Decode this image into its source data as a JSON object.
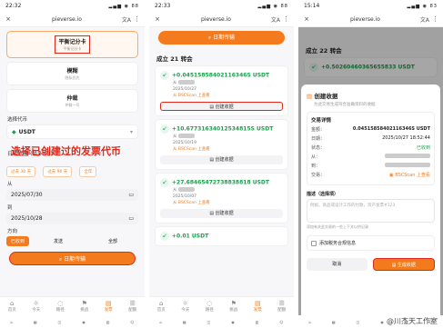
{
  "status": {
    "p1_time": "22:32",
    "p2_time": "22:33",
    "p3_time": "15:14",
    "battery1": "88",
    "battery2": "88",
    "battery3": "83"
  },
  "browser": {
    "url": "pieverse.io",
    "translate": "文A",
    "close": "×"
  },
  "p1": {
    "cards": [
      {
        "title": "平衡记分卡",
        "sub": "平衡记分卡"
      },
      {
        "title": "模糊",
        "sub": "隐私优先"
      },
      {
        "title": "仲裁",
        "sub": "仲裁一号"
      }
    ],
    "select_label": "选择代币",
    "token": "USDT",
    "token_sub": "ERC20 · 由 USDT 提供",
    "range_label": "日期范围（最多3年）",
    "chips": [
      "过去 30 天",
      "过去 90 天",
      "全年"
    ],
    "from_label": "从",
    "from_val": "2025/07/30",
    "to_label": "到",
    "to_val": "2025/10/28",
    "dir_label": "方向",
    "dir": [
      "已收到",
      "发送",
      "全部"
    ],
    "gen_btn": "日期传输"
  },
  "overlay_text": "选择已创建过的发票代币",
  "p2": {
    "top_btn": "日期传输",
    "count": "成立 21 转会",
    "txs": [
      {
        "amt": "+0.04515858402116346S USDT",
        "date": "2025/10/27",
        "src": "从 BSCScan 上查看",
        "btn": "创建收据"
      },
      {
        "amt": "+10.67731634012534815S USDT",
        "date": "2025/10/19",
        "src": "从 BSCScan 上查看",
        "btn": "创建收据"
      },
      {
        "amt": "+27.68465472738838818 USDT",
        "date": "2025/10/07",
        "src": "从 BSCScan 上查看",
        "btn": "创建收据"
      },
      {
        "amt": "+0.01 USDT",
        "date": "",
        "src": "",
        "btn": ""
      }
    ]
  },
  "p3": {
    "count": "成立 22 转会",
    "bg_amt": "+0.50260460365655833 USDT",
    "dlg_title": "创建收据",
    "dlg_sub": "为此交易生成符合准确资料的收据",
    "detail_title": "交易详情",
    "amount_lbl": "金额：",
    "amount": "0.04515858402116346S USDT",
    "date_lbl": "日期：",
    "date": "2025/10/27 18:52:44",
    "status_lbl": "状态：",
    "status": "已收到",
    "from_lbl": "从：",
    "to_lbl": "到：",
    "tx_lbl": "交易：",
    "tx_link": "BSCScan 上查看",
    "desc_lbl": "描述（选择项）",
    "desc_ph": "例如，商品或设计工作的付款，资产发票#123",
    "desc_hint": "添加有关此交易的一些上下文以供记录",
    "tax_lbl": "添加税务合规信息",
    "cancel": "取消",
    "generate": "生成收据"
  },
  "nav": [
    "首页",
    "今天",
    "路径",
    "挑战",
    "发票",
    "配额"
  ],
  "sysnav": [
    "首页",
    "",
    "",
    "",
    "",
    ""
  ],
  "credit": "@川杰天工作室"
}
